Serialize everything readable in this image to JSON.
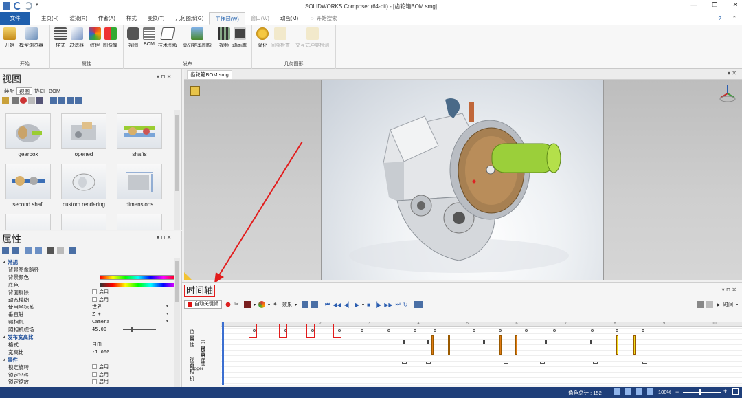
{
  "window": {
    "title": "SOLIDWORKS Composer (64-bit) - [齿轮箱BOM.smg]"
  },
  "ribbon_tabs": [
    {
      "label": "文件",
      "state": "file"
    },
    {
      "label": "主页(H)",
      "state": ""
    },
    {
      "label": "渲染(R)",
      "state": ""
    },
    {
      "label": "作者(A)",
      "state": ""
    },
    {
      "label": "样式",
      "state": ""
    },
    {
      "label": "变换(T)",
      "state": ""
    },
    {
      "label": "几何图形(G)",
      "state": ""
    },
    {
      "label": "工作间(W)",
      "state": "active"
    },
    {
      "label": "窗口(W)",
      "state": "dim"
    },
    {
      "label": "动画(M)",
      "state": ""
    }
  ],
  "search": {
    "placeholder": "开始搜索"
  },
  "ribbon_groups": {
    "start": {
      "label": "开始",
      "buttons": [
        {
          "label": "开始",
          "icon": "home-icon"
        },
        {
          "label": "模型浏览器",
          "icon": "model-browser-icon"
        }
      ]
    },
    "properties": {
      "label": "属性",
      "buttons": [
        {
          "label": "样式",
          "icon": "style-icon"
        },
        {
          "label": "过滤器",
          "icon": "filter-icon"
        },
        {
          "label": "纹理",
          "icon": "texture-icon"
        },
        {
          "label": "图像库",
          "icon": "image-library-icon"
        }
      ]
    },
    "publish": {
      "label": "发布",
      "buttons": [
        {
          "label": "视图",
          "icon": "camera-icon"
        },
        {
          "label": "BOM",
          "icon": "bom-icon"
        },
        {
          "label": "技术图解",
          "icon": "tech-illustration-icon"
        },
        {
          "label": "高分辨率图像",
          "icon": "hires-image-icon"
        },
        {
          "label": "视频",
          "icon": "video-icon"
        },
        {
          "label": "动画库",
          "icon": "animation-library-icon"
        }
      ]
    },
    "geometry": {
      "label": "几何图形",
      "buttons": [
        {
          "label": "简化",
          "icon": "simplify-icon",
          "dim": false
        },
        {
          "label": "间隙检查",
          "icon": "clearance-icon",
          "dim": true
        },
        {
          "label": "交互式冲突检测",
          "icon": "collision-icon",
          "dim": true
        }
      ]
    }
  },
  "view_panel": {
    "title": "视图",
    "tabs": [
      "装配",
      "视图",
      "协同",
      "BOM"
    ],
    "active_tab": 1,
    "thumbnails": [
      "gearbox",
      "opened",
      "shafts",
      "second shaft",
      "custom rendering",
      "dimensions"
    ]
  },
  "props_panel": {
    "title": "属性",
    "rows": [
      {
        "type": "section",
        "key": "常规"
      },
      {
        "type": "row",
        "key": "背景图像路径",
        "value": ""
      },
      {
        "type": "color",
        "key": "背景颜色",
        "value": ""
      },
      {
        "type": "color2",
        "key": "底色",
        "value": ""
      },
      {
        "type": "check",
        "key": "背面剔除",
        "value": "启用"
      },
      {
        "type": "check",
        "key": "动态模糊",
        "value": "启用"
      },
      {
        "type": "row",
        "key": "使用坐标系",
        "value": "世界"
      },
      {
        "type": "row",
        "key": "垂直轴",
        "value": "Z +"
      },
      {
        "type": "row",
        "key": "照相机",
        "value": "Camera"
      },
      {
        "type": "slider",
        "key": "照相机视场",
        "value": "45.00"
      },
      {
        "type": "section",
        "key": "发布宽高比"
      },
      {
        "type": "row",
        "key": "格式",
        "value": "自由"
      },
      {
        "type": "row",
        "key": "宽高比",
        "value": "-1.000"
      },
      {
        "type": "section",
        "key": "事件"
      },
      {
        "type": "check",
        "key": "锁定旋转",
        "value": "启用"
      },
      {
        "type": "check",
        "key": "锁定平移",
        "value": "启用"
      },
      {
        "type": "check",
        "key": "锁定缩放",
        "value": "启用"
      }
    ]
  },
  "document": {
    "tab": "齿轮箱BOM.smg"
  },
  "timeline": {
    "title": "时间轴",
    "autokey_label": "自动关键帧",
    "effects_label": "效果",
    "mode_label": "时间",
    "ruler_ticks": [
      "1",
      "2",
      "3",
      "4",
      "5",
      "6",
      "7",
      "8",
      "9",
      "10"
    ],
    "tracks": [
      "位置",
      "属性",
      "不透明度",
      "材料",
      "事件",
      "视口",
      "照相机",
      "Digger"
    ]
  },
  "status": {
    "angle_total": "角色总计 : 152",
    "zoom": "100%"
  },
  "colors": {
    "file_tab": "#1f5fad",
    "status_bar": "#1f3f7a",
    "highlight": "#e21b1b",
    "orange_key": "#e07b14",
    "yellow_key": "#f0e020"
  }
}
